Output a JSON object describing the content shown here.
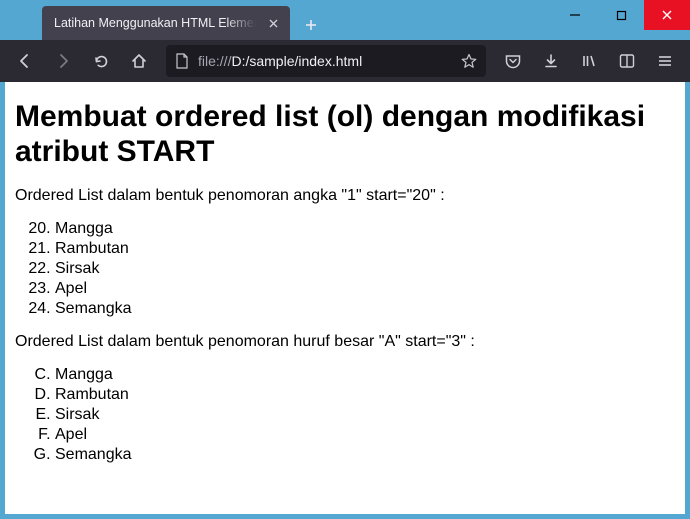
{
  "window": {
    "tab_title": "Latihan Menggunakan HTML Elemen",
    "url_display_prefix": "file:///",
    "url_display_path": "D:/sample/index.html"
  },
  "content": {
    "heading": "Membuat ordered list (ol) dengan modifikasi atribut START",
    "intro1": "Ordered List dalam bentuk penomoran angka \"1\" start=\"20\" :",
    "intro2": "Ordered List dalam bentuk penomoran huruf besar \"A\" start=\"3\" :",
    "list1_start": 20,
    "list1_items": [
      "Mangga",
      "Rambutan",
      "Sirsak",
      "Apel",
      "Semangka"
    ],
    "list2_start": 3,
    "list2_items": [
      "Mangga",
      "Rambutan",
      "Sirsak",
      "Apel",
      "Semangka"
    ]
  }
}
